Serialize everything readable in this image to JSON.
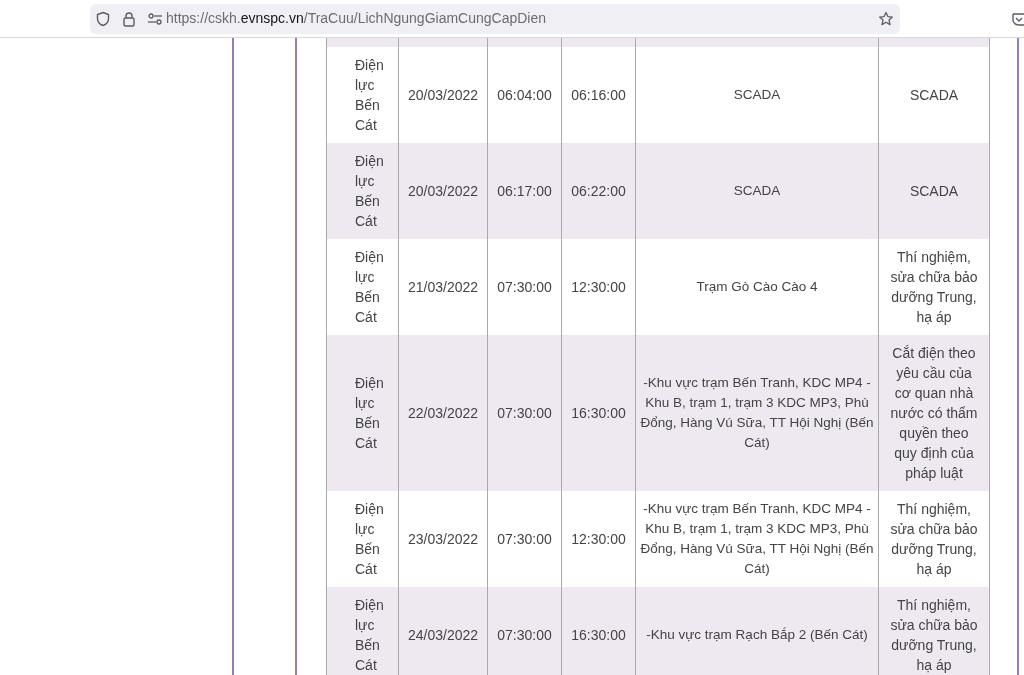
{
  "address_bar": {
    "url_parts": [
      {
        "kind": "plain",
        "text": "https://cskh."
      },
      {
        "kind": "domain",
        "text": "evnspc.vn"
      },
      {
        "kind": "plain",
        "text": "/TraCuu/LichNgungGiamCungCapDien"
      }
    ]
  },
  "table": {
    "rows": [
      {
        "unit": "Điện lực Bến Cát",
        "date": "20/03/2022",
        "start": "06:04:00",
        "end": "06:16:00",
        "area": "SCADA",
        "reason": "SCADA"
      },
      {
        "unit": "Điện lực Bến Cát",
        "date": "20/03/2022",
        "start": "06:17:00",
        "end": "06:22:00",
        "area": "SCADA",
        "reason": "SCADA"
      },
      {
        "unit": "Điện lực Bến Cát",
        "date": "21/03/2022",
        "start": "07:30:00",
        "end": "12:30:00",
        "area": "Trạm Gò Cào Cào 4",
        "reason": "Thí nghiệm, sửa chữa bảo dưỡng Trung, hạ áp"
      },
      {
        "unit": "Điện lực Bến Cát",
        "date": "22/03/2022",
        "start": "07:30:00",
        "end": "16:30:00",
        "area": "-Khu vực trạm Bến Tranh, KDC MP4 - Khu B, trạm 1, trạm 3 KDC MP3, Phù Đổng, Hàng Vú Sữa, TT Hội Nghị (Bến Cát)",
        "reason": "Cắt điện theo yêu cầu của cơ quan nhà nước có thẩm quyền theo quy định của pháp luật"
      },
      {
        "unit": "Điện lực Bến Cát",
        "date": "23/03/2022",
        "start": "07:30:00",
        "end": "12:30:00",
        "area": "-Khu vực trạm Bến Tranh, KDC MP4 - Khu B, trạm 1, trạm 3 KDC MP3, Phù Đổng, Hàng Vú Sữa, TT Hội Nghị (Bến Cát)",
        "reason": "Thí nghiệm, sửa chữa bảo dưỡng Trung, hạ áp"
      },
      {
        "unit": "Điện lực Bến Cát",
        "date": "24/03/2022",
        "start": "07:30:00",
        "end": "16:30:00",
        "area": "-Khu vực trạm Rạch Bắp 2 (Bến Cát)",
        "reason": "Thí nghiệm, sửa chữa bảo dưỡng Trung, hạ áp"
      }
    ]
  }
}
